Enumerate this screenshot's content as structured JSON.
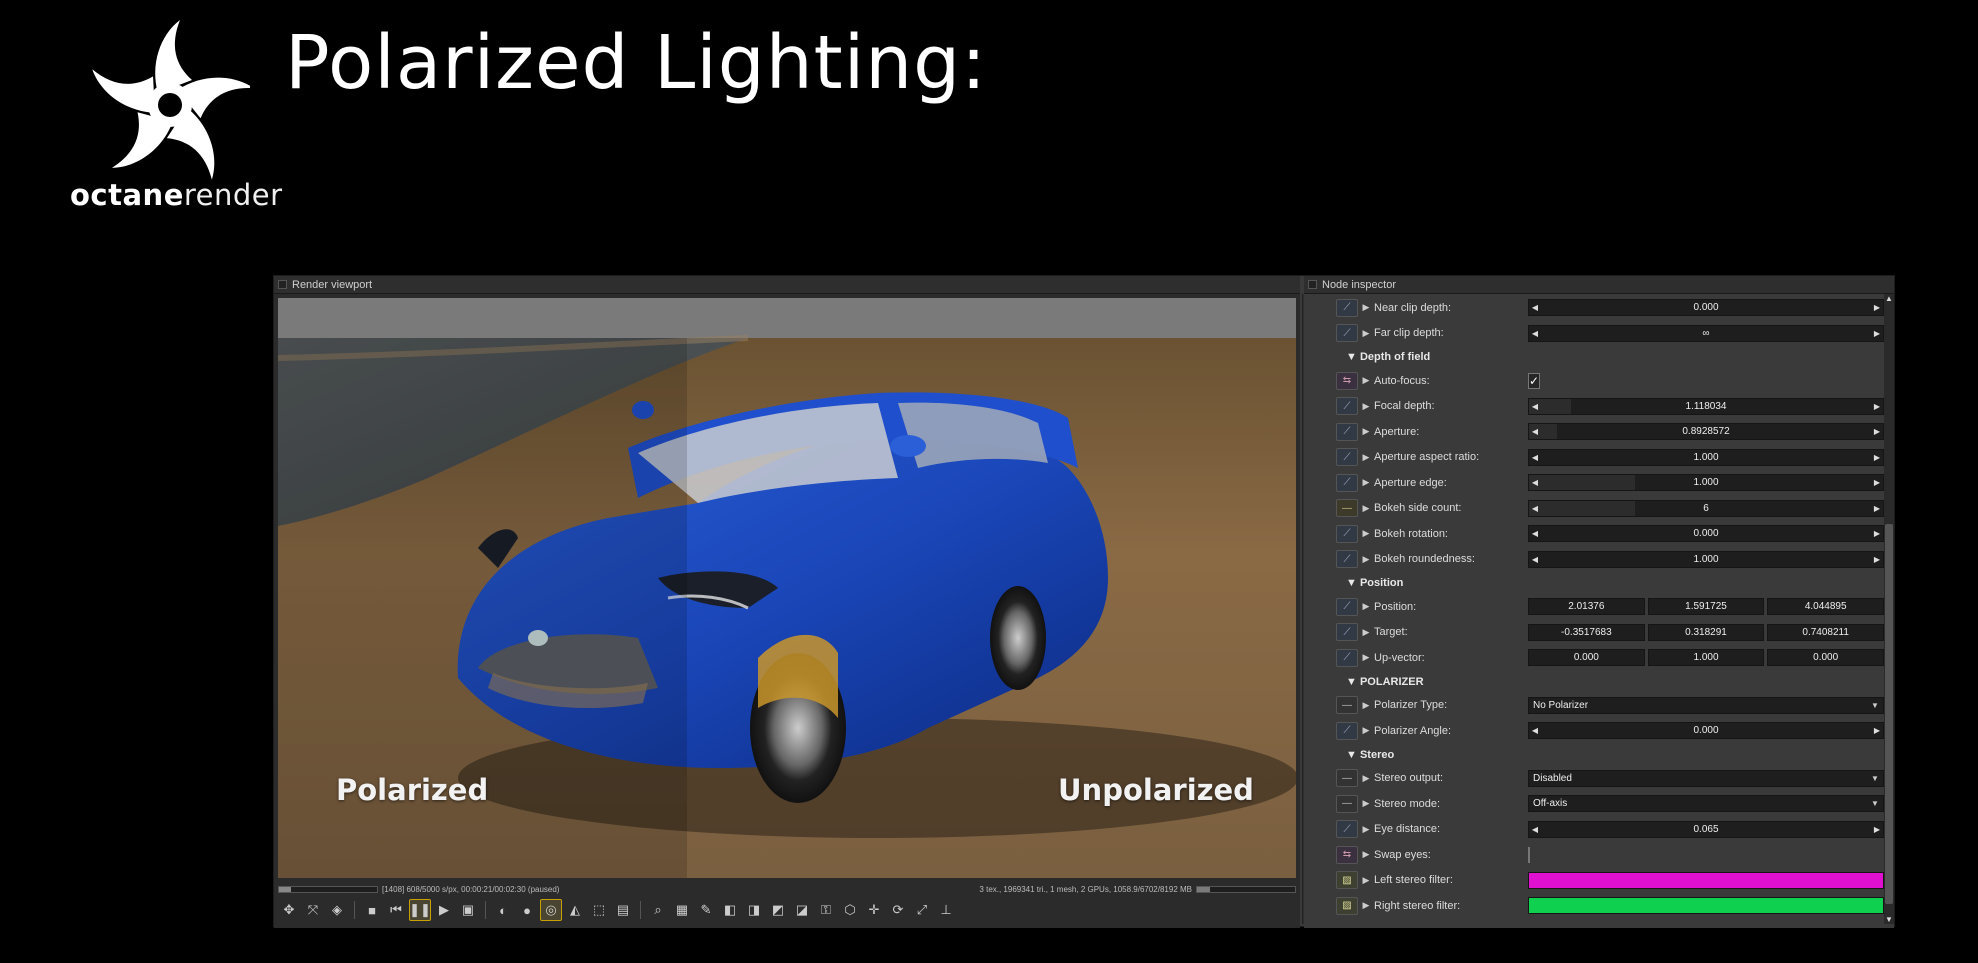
{
  "slide": {
    "title": "Polarized Lighting:",
    "brand_part1": "octane",
    "brand_part2": "render"
  },
  "viewport": {
    "title": "Render viewport",
    "label_left": "Polarized",
    "label_right": "Unpolarized",
    "status_left": "[1408] 608/5000 s/px, 00:00:21/00:02:30 (paused)",
    "status_right": "3 tex., 1969341 tri., 1 mesh, 2 GPUs, 1058.9/6702/8192 MB",
    "progress": 0.12,
    "vram_usage": 0.13
  },
  "inspector": {
    "title": "Node inspector",
    "rows_top": [
      {
        "label": "Near clip depth:",
        "value": "0.000",
        "pin": "float",
        "fill": 0.0
      },
      {
        "label": "Far clip depth:",
        "value": "∞",
        "pin": "float",
        "fill": 0.0
      }
    ],
    "dof": {
      "section": "Depth of field",
      "autofocus_label": "Auto-focus:",
      "autofocus_checked": "✓",
      "rows": [
        {
          "label": "Focal depth:",
          "value": "1.118034",
          "pin": "float",
          "fill": 0.12
        },
        {
          "label": "Aperture:",
          "value": "0.8928572",
          "pin": "float",
          "fill": 0.08
        },
        {
          "label": "Aperture aspect ratio:",
          "value": "1.000",
          "pin": "float",
          "fill": 0.0
        },
        {
          "label": "Aperture edge:",
          "value": "1.000",
          "pin": "float",
          "fill": 0.3
        },
        {
          "label": "Bokeh side count:",
          "value": "6",
          "pin": "int",
          "fill": 0.3
        },
        {
          "label": "Bokeh rotation:",
          "value": "0.000",
          "pin": "float",
          "fill": 0.0
        },
        {
          "label": "Bokeh roundedness:",
          "value": "1.000",
          "pin": "float",
          "fill": 0.0
        }
      ]
    },
    "position": {
      "section": "Position",
      "rows": [
        {
          "label": "Position:",
          "v": [
            "2.01376",
            "1.591725",
            "4.044895"
          ]
        },
        {
          "label": "Target:",
          "v": [
            "-0.3517683",
            "0.318291",
            "0.7408211"
          ]
        },
        {
          "label": "Up-vector:",
          "v": [
            "0.000",
            "1.000",
            "0.000"
          ]
        }
      ]
    },
    "polarizer": {
      "section": "POLARIZER",
      "type_label": "Polarizer Type:",
      "type_value": "No Polarizer",
      "angle_label": "Polarizer Angle:",
      "angle_value": "0.000"
    },
    "stereo": {
      "section": "Stereo",
      "output_label": "Stereo output:",
      "output_value": "Disabled",
      "mode_label": "Stereo mode:",
      "mode_value": "Off-axis",
      "eye_label": "Eye distance:",
      "eye_value": "0.065",
      "swap_label": "Swap eyes:",
      "left_filter_label": "Left stereo filter:",
      "left_filter_color": "#e010d0",
      "right_filter_label": "Right stereo filter:",
      "right_filter_color": "#10d050"
    }
  }
}
